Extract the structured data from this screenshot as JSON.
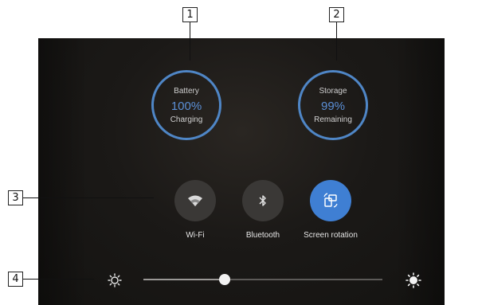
{
  "callouts": [
    "1",
    "2",
    "3",
    "4"
  ],
  "battery": {
    "label": "Battery",
    "value": "100%",
    "status": "Charging"
  },
  "storage": {
    "label": "Storage",
    "value": "99%",
    "status": "Remaining"
  },
  "toggles": [
    {
      "label": "Wi-Fi",
      "icon": "wifi-icon",
      "active": false
    },
    {
      "label": "Bluetooth",
      "icon": "bluetooth-icon",
      "active": false
    },
    {
      "label": "Screen rotation",
      "icon": "screen-rotation-icon",
      "active": true
    }
  ],
  "brightness": {
    "level": 0.34
  },
  "colors": {
    "accent": "#3f7fd3",
    "ring": "#4f86c6",
    "panel": "#1b1917"
  }
}
